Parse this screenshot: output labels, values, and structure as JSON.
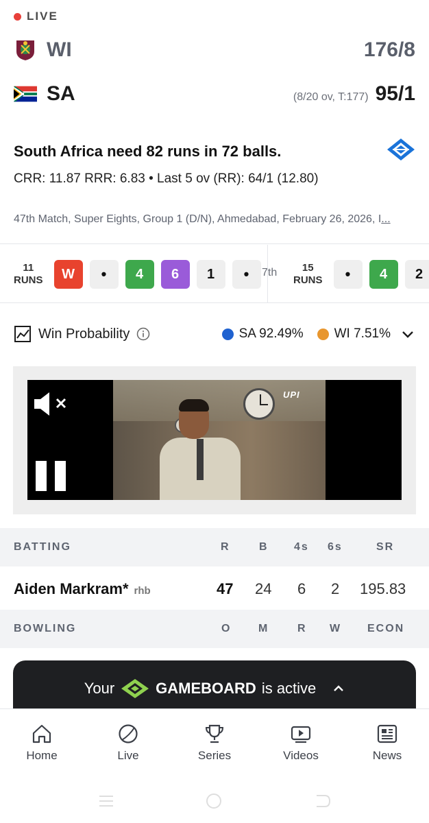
{
  "status": {
    "live_label": "LIVE",
    "live_color": "#e8403a"
  },
  "teams": [
    {
      "abbr": "WI",
      "score": "176/8",
      "overs": "",
      "flag_icon": "west-indies-flag-icon"
    },
    {
      "abbr": "SA",
      "score": "95/1",
      "overs": "(8/20 ov, T:177)",
      "flag_icon": "south-africa-flag-icon"
    }
  ],
  "summary": {
    "need_text": "South Africa need 82 runs in 72 balls.",
    "rates_text": "CRR: 11.87  RRR: 6.83 • Last 5 ov (RR): 64/1 (12.80)",
    "match_info": "47th Match, Super Eights, Group 1 (D/N), Ahmedabad, February 26, 2026, I",
    "match_info_more": "..."
  },
  "overs_strip": {
    "previous": {
      "runs": "11",
      "runs_label": "RUNS",
      "balls": [
        "W",
        "•",
        "4",
        "6",
        "1",
        "•"
      ]
    },
    "current_over_label": "7th",
    "current": {
      "runs": "15",
      "runs_label": "RUNS",
      "balls": [
        "•",
        "4",
        "2"
      ]
    }
  },
  "win_probability": {
    "title": "Win Probability",
    "teams": [
      {
        "label": "SA 92.49%",
        "color": "#1f62d0"
      },
      {
        "label": "WI 7.51%",
        "color": "#e8962e"
      }
    ]
  },
  "video": {
    "overlay_logo": "UPI"
  },
  "batting": {
    "headers": [
      "BATTING",
      "R",
      "B",
      "4s",
      "6s",
      "SR"
    ],
    "rows": [
      {
        "name": "Aiden Markram*",
        "hand": "rhb",
        "r": "47",
        "b": "24",
        "fours": "6",
        "sixes": "2",
        "sr": "195.83"
      }
    ]
  },
  "bowling": {
    "headers": [
      "BOWLING",
      "O",
      "M",
      "R",
      "W",
      "ECON"
    ]
  },
  "gameboard": {
    "prefix": "Your",
    "brand": "GAMEBOARD",
    "suffix": "is active",
    "accent": "#8fd14f"
  },
  "nav": [
    {
      "label": "Home",
      "icon": "home-icon"
    },
    {
      "label": "Live",
      "icon": "cricket-ball-icon"
    },
    {
      "label": "Series",
      "icon": "trophy-icon"
    },
    {
      "label": "Videos",
      "icon": "video-icon"
    },
    {
      "label": "News",
      "icon": "news-icon"
    }
  ],
  "colors": {
    "four": "#3ea84c",
    "six": "#9a5bd9",
    "wicket": "#e8432e",
    "dot": "#efefef"
  }
}
